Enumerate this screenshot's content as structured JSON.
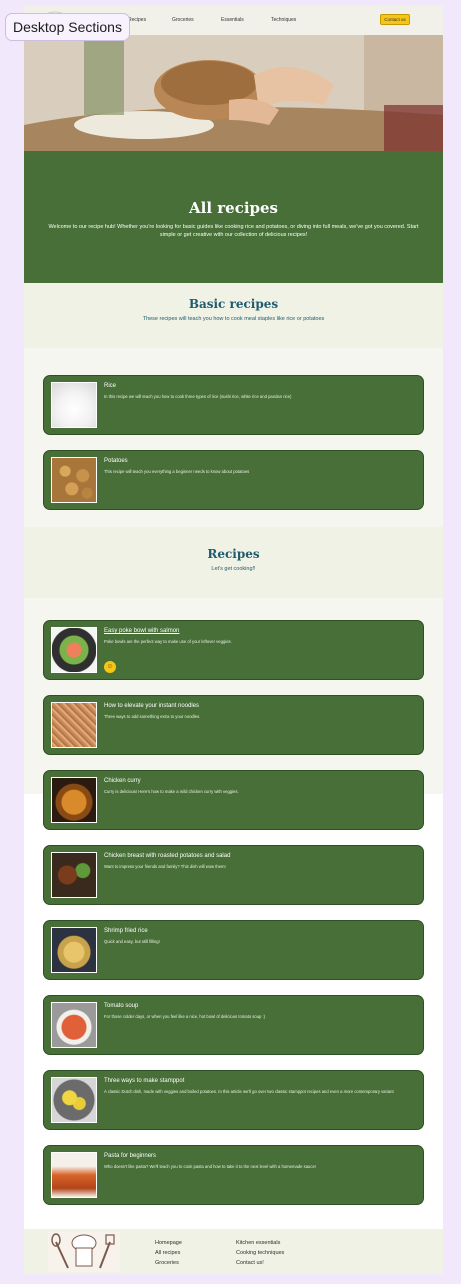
{
  "frame_label": "Desktop Sections",
  "nav": {
    "links": [
      "Recipes",
      "Groceries",
      "Essentials",
      "Techniques"
    ],
    "cta": "Contact us"
  },
  "intro": {
    "title": "All recipes",
    "text": "Welcome to our recipe hub! Whether you're looking for basic guides like cooking rice and potatoes, or diving into full meals, we've got you covered. Start simple or get creative with our collection of delicious recipes!"
  },
  "basic": {
    "title": "Basic recipes",
    "subtitle": "These recipes will teach you how to cook meal staples like rice or potatoes",
    "cards": [
      {
        "title": "Rice",
        "desc": "In this recipe we will teach you how to cook three types of rice (sushi rice, white rice and pandan rice)"
      },
      {
        "title": "Potatoes",
        "desc": "This recipe will teach you everything a beginner needs to know about potatoes"
      }
    ]
  },
  "recipes": {
    "title": "Recipes",
    "subtitle": "Let's get cooking!!",
    "cards": [
      {
        "title": "Easy poke bowl with salmon",
        "desc": "Poke bowls are the perfect way to make use of your leftover veggies."
      },
      {
        "title": "How to elevate your instant noodles",
        "desc": "Three ways to add something extra to your noodles."
      },
      {
        "title": "Chicken curry",
        "desc": "Curry is delicious! Here's how to make a mild chicken curry with veggies."
      },
      {
        "title": "Chicken breast with roasted potatoes and salad",
        "desc": "Want to impress your friends and family? This dish will wow them!"
      },
      {
        "title": "Shrimp fried rice",
        "desc": "Quick and easy, but still filling!"
      },
      {
        "title": "Tomato soup",
        "desc": "For those colder days, or when you feel like a nice, hot bowl of delicious tomato soup :)"
      },
      {
        "title": "Three ways to make stamppot",
        "desc": "A classic Dutch dish, made with veggies and boiled potatoes. In this article we'll go over two classic stamppot recipes and even a more contemporary variant"
      },
      {
        "title": "Pasta for beginners",
        "desc": "Who doesn't like pasta? We'll teach you to cook pasta and how to take it to the next level with a homemade sauce!"
      }
    ]
  },
  "footer": {
    "col1": [
      "Homepage",
      "All recipes",
      "Groceries"
    ],
    "col2": [
      "Kitchen essentials",
      "Cooking techniques",
      "Contact us!"
    ]
  },
  "colors": {
    "green": "#476f37",
    "cream": "#eff2e5",
    "heading_blue": "#1f5a6e",
    "accent_yellow": "#f5c518"
  }
}
